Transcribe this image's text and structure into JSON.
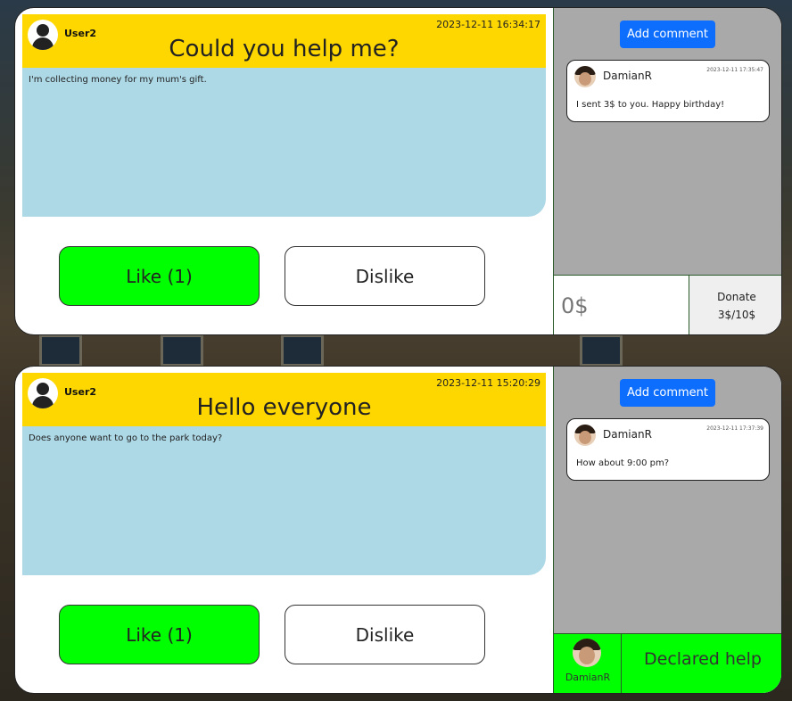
{
  "posts": [
    {
      "username": "User2",
      "timestamp": "2023-12-11 16:34:17",
      "title": "Could you help me?",
      "body": "I'm collecting money for my mum's gift.",
      "like_label": "Like (1)",
      "dislike_label": "Dislike",
      "add_comment_label": "Add comment",
      "comment": {
        "author": "DamianR",
        "time": "2023-12-11 17:35:47",
        "text": "I sent 3$ to you. Happy birthday!"
      },
      "donate": {
        "input_placeholder": "0$",
        "button_label": "Donate",
        "progress_text": "3$/10$"
      }
    },
    {
      "username": "User2",
      "timestamp": "2023-12-11 15:20:29",
      "title": "Hello everyone",
      "body": "Does anyone want to go to the park today?",
      "like_label": "Like (1)",
      "dislike_label": "Dislike",
      "add_comment_label": "Add comment",
      "comment": {
        "author": "DamianR",
        "time": "2023-12-11 17:37:39",
        "text": "How about 9:00 pm?"
      },
      "helper": {
        "name": "DamianR",
        "status": "Declared help"
      }
    }
  ],
  "colors": {
    "header": "#ffd700",
    "body": "#add8e6",
    "like": "#00ff00",
    "add_comment": "#0d6efd",
    "sidebar": "#a9a9a9"
  }
}
